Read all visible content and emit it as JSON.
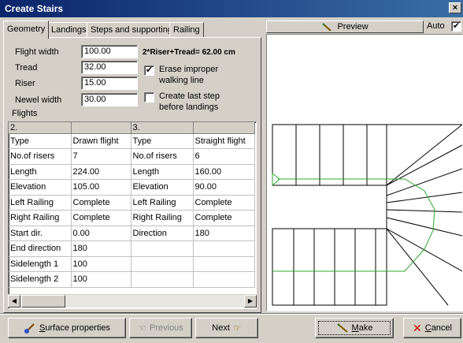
{
  "window": {
    "title": "Create Stairs",
    "close_glyph": "×"
  },
  "tabs": [
    {
      "label": "Geometry",
      "active": true
    },
    {
      "label": "Landings",
      "active": false
    },
    {
      "label": "Steps and supporting",
      "active": false
    },
    {
      "label": "Railing",
      "active": false
    }
  ],
  "geometry": {
    "flight_width": {
      "label": "Flight width",
      "value": "100.00"
    },
    "tread": {
      "label": "Tread",
      "value": "32.00"
    },
    "riser": {
      "label": "Riser",
      "value": "15.00"
    },
    "newel_width": {
      "label": "Newel width",
      "value": "30.00"
    },
    "formula": "2*Riser+Tread= 62.00 cm",
    "erase_improper": {
      "label_line1": "Erase improper",
      "label_line2": "walking line",
      "checked": true,
      "mark": "✔"
    },
    "create_last_step": {
      "label_line1": "Create last step",
      "label_line2": "before landings",
      "checked": false
    },
    "flights_label": "Flights"
  },
  "flights_grid": {
    "headers": [
      "2.",
      "",
      "3.",
      ""
    ],
    "rows": [
      [
        "Type",
        "Drawn flight",
        "Type",
        "Straight flight"
      ],
      [
        "No.of risers",
        "7",
        "No.of risers",
        "6"
      ],
      [
        "Length",
        "224.00",
        "Length",
        "160.00"
      ],
      [
        "Elevation",
        "105.00",
        "Elevation",
        "90.00"
      ],
      [
        "Left Railing",
        "Complete",
        "Left Railing",
        "Complete"
      ],
      [
        "Right Railing",
        "Complete",
        "Right Railing",
        "Complete"
      ],
      [
        "Start dir.",
        "0.00",
        "Direction",
        "180"
      ],
      [
        "End direction",
        "180",
        "",
        ""
      ],
      [
        "Sidelength 1",
        "100",
        "",
        ""
      ],
      [
        "Sidelength 2",
        "100",
        "",
        ""
      ]
    ]
  },
  "scroll": {
    "left_glyph": "◀",
    "right_glyph": "▶"
  },
  "preview": {
    "button_label": "Preview",
    "auto_label": "Auto",
    "auto_checked": true,
    "auto_mark": "✔"
  },
  "buttons": {
    "surface": {
      "label": "Surface properties",
      "accel": "S",
      "rest": "urface properties"
    },
    "previous": {
      "label": "Previous"
    },
    "next": {
      "label": "Next"
    },
    "make": {
      "label": "Make",
      "accel": "M",
      "rest": "ake"
    },
    "cancel": {
      "label": "Cancel",
      "accel": "C",
      "rest": "ancel"
    }
  },
  "colors": {
    "title_start": "#0a246a",
    "title_end": "#3a6ea5",
    "walking_line": "#2ea82e",
    "cancel_x": "#cc0000"
  }
}
